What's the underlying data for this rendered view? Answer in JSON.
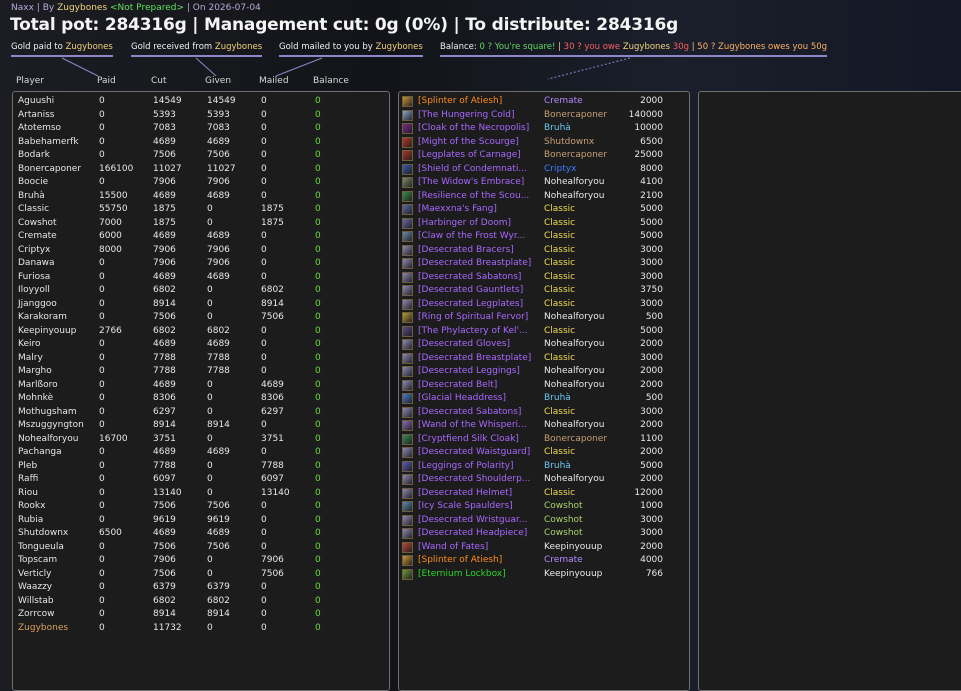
{
  "header": {
    "raid": "Naxx",
    "by_label": "By",
    "author": "Zugybones",
    "status": "<Not Prepared>",
    "on_label": "On",
    "date": "2026-07-04",
    "title": "Total pot: 284316g | Management cut: 0g (0%) | To distribute: 284316g"
  },
  "legend": {
    "paid_label": "Gold paid to",
    "received_label": "Gold received from",
    "mailed_label": "Gold mailed to you by",
    "name": "Zugybones",
    "balance_label": "Balance:",
    "square": "0 ? You're square!",
    "owe_pre": "30 ? you owe",
    "owe_amt": "30g",
    "owes_pre": "50 ? Zugybones owes you",
    "owes_amt": "50g",
    "sep": "|"
  },
  "columns": [
    "Player",
    "Paid",
    "Cut",
    "Given",
    "Mailed",
    "Balance"
  ],
  "players": [
    {
      "name": "Aguushi",
      "paid": "0",
      "cut": "14549",
      "given": "14549",
      "mailed": "0",
      "balance": "0"
    },
    {
      "name": "Artaniss",
      "paid": "0",
      "cut": "5393",
      "given": "5393",
      "mailed": "0",
      "balance": "0"
    },
    {
      "name": "Atotemso",
      "paid": "0",
      "cut": "7083",
      "given": "7083",
      "mailed": "0",
      "balance": "0"
    },
    {
      "name": "Babehamerfk",
      "paid": "0",
      "cut": "4689",
      "given": "4689",
      "mailed": "0",
      "balance": "0"
    },
    {
      "name": "Bodark",
      "paid": "0",
      "cut": "7506",
      "given": "7506",
      "mailed": "0",
      "balance": "0"
    },
    {
      "name": "Bonercaponer",
      "paid": "166100",
      "cut": "11027",
      "given": "11027",
      "mailed": "0",
      "balance": "0"
    },
    {
      "name": "Boocie",
      "paid": "0",
      "cut": "7906",
      "given": "7906",
      "mailed": "0",
      "balance": "0"
    },
    {
      "name": "Bruhà",
      "paid": "15500",
      "cut": "4689",
      "given": "4689",
      "mailed": "0",
      "balance": "0"
    },
    {
      "name": "Classic",
      "paid": "55750",
      "cut": "1875",
      "given": "0",
      "mailed": "1875",
      "balance": "0"
    },
    {
      "name": "Cowshot",
      "paid": "7000",
      "cut": "1875",
      "given": "0",
      "mailed": "1875",
      "balance": "0"
    },
    {
      "name": "Cremate",
      "paid": "6000",
      "cut": "4689",
      "given": "4689",
      "mailed": "0",
      "balance": "0"
    },
    {
      "name": "Criptyx",
      "paid": "8000",
      "cut": "7906",
      "given": "7906",
      "mailed": "0",
      "balance": "0"
    },
    {
      "name": "Danawa",
      "paid": "0",
      "cut": "7906",
      "given": "7906",
      "mailed": "0",
      "balance": "0"
    },
    {
      "name": "Furiosa",
      "paid": "0",
      "cut": "4689",
      "given": "4689",
      "mailed": "0",
      "balance": "0"
    },
    {
      "name": "Iloyyoll",
      "paid": "0",
      "cut": "6802",
      "given": "0",
      "mailed": "6802",
      "balance": "0"
    },
    {
      "name": "Jjanggoo",
      "paid": "0",
      "cut": "8914",
      "given": "0",
      "mailed": "8914",
      "balance": "0"
    },
    {
      "name": "Karakoram",
      "paid": "0",
      "cut": "7506",
      "given": "0",
      "mailed": "7506",
      "balance": "0"
    },
    {
      "name": "Keepinyouup",
      "paid": "2766",
      "cut": "6802",
      "given": "6802",
      "mailed": "0",
      "balance": "0"
    },
    {
      "name": "Keiro",
      "paid": "0",
      "cut": "4689",
      "given": "4689",
      "mailed": "0",
      "balance": "0"
    },
    {
      "name": "Malry",
      "paid": "0",
      "cut": "7788",
      "given": "7788",
      "mailed": "0",
      "balance": "0"
    },
    {
      "name": "Margho",
      "paid": "0",
      "cut": "7788",
      "given": "7788",
      "mailed": "0",
      "balance": "0"
    },
    {
      "name": "Marlßoro",
      "paid": "0",
      "cut": "4689",
      "given": "0",
      "mailed": "4689",
      "balance": "0"
    },
    {
      "name": "Mohnkè",
      "paid": "0",
      "cut": "8306",
      "given": "0",
      "mailed": "8306",
      "balance": "0"
    },
    {
      "name": "Mothugsham",
      "paid": "0",
      "cut": "6297",
      "given": "0",
      "mailed": "6297",
      "balance": "0"
    },
    {
      "name": "Mszuggyngton",
      "paid": "0",
      "cut": "8914",
      "given": "8914",
      "mailed": "0",
      "balance": "0"
    },
    {
      "name": "Nohealforyou",
      "paid": "16700",
      "cut": "3751",
      "given": "0",
      "mailed": "3751",
      "balance": "0"
    },
    {
      "name": "Pachanga",
      "paid": "0",
      "cut": "4689",
      "given": "4689",
      "mailed": "0",
      "balance": "0"
    },
    {
      "name": "Pleb",
      "paid": "0",
      "cut": "7788",
      "given": "0",
      "mailed": "7788",
      "balance": "0"
    },
    {
      "name": "Raffi",
      "paid": "0",
      "cut": "6097",
      "given": "0",
      "mailed": "6097",
      "balance": "0"
    },
    {
      "name": "Riou",
      "paid": "0",
      "cut": "13140",
      "given": "0",
      "mailed": "13140",
      "balance": "0"
    },
    {
      "name": "Rookx",
      "paid": "0",
      "cut": "7506",
      "given": "7506",
      "mailed": "0",
      "balance": "0"
    },
    {
      "name": "Rubia",
      "paid": "0",
      "cut": "9619",
      "given": "9619",
      "mailed": "0",
      "balance": "0"
    },
    {
      "name": "Shutdownx",
      "paid": "6500",
      "cut": "4689",
      "given": "4689",
      "mailed": "0",
      "balance": "0"
    },
    {
      "name": "Tongueula",
      "paid": "0",
      "cut": "7506",
      "given": "7506",
      "mailed": "0",
      "balance": "0"
    },
    {
      "name": "Topscam",
      "paid": "0",
      "cut": "7906",
      "given": "0",
      "mailed": "7906",
      "balance": "0"
    },
    {
      "name": "Verticly",
      "paid": "0",
      "cut": "7506",
      "given": "0",
      "mailed": "7506",
      "balance": "0"
    },
    {
      "name": "Waazzy",
      "paid": "0",
      "cut": "6379",
      "given": "6379",
      "mailed": "0",
      "balance": "0"
    },
    {
      "name": "Willstab",
      "paid": "0",
      "cut": "6802",
      "given": "6802",
      "mailed": "0",
      "balance": "0"
    },
    {
      "name": "Zorrcow",
      "paid": "0",
      "cut": "8914",
      "given": "8914",
      "mailed": "0",
      "balance": "0"
    },
    {
      "name": "Zugybones",
      "paid": "0",
      "cut": "11732",
      "given": "0",
      "mailed": "0",
      "balance": "0",
      "is_self": true
    }
  ],
  "loot": [
    {
      "item": "[Splinter of Atiesh]",
      "quality": "legendary",
      "icon": "splinter-icon",
      "icon_color": "#c9953a",
      "winner": "Cremate",
      "winner_color": "#b38cff",
      "amount": "2000"
    },
    {
      "item": "[The Hungering Cold]",
      "quality": "epic",
      "icon": "sword-icon",
      "icon_color": "#8aa6c8",
      "winner": "Bonercaponer",
      "winner_color": "#c89f74",
      "amount": "140000"
    },
    {
      "item": "[Cloak of the Necropolis]",
      "quality": "epic",
      "icon": "cloak-icon",
      "icon_color": "#7a2a8a",
      "winner": "Bruhà",
      "winner_color": "#6bc8f0",
      "amount": "10000"
    },
    {
      "item": "[Might of the Scourge]",
      "quality": "epic",
      "icon": "shoulder-icon",
      "icon_color": "#b83a2a",
      "winner": "Shutdownx",
      "winner_color": "#c89f74",
      "amount": "6500"
    },
    {
      "item": "[Legplates of Carnage]",
      "quality": "epic",
      "icon": "legs-icon",
      "icon_color": "#a83a2a",
      "winner": "Bonercaponer",
      "winner_color": "#c89f74",
      "amount": "25000"
    },
    {
      "item": "[Shield of Condemnati...",
      "quality": "epic",
      "icon": "shield-icon",
      "icon_color": "#3a5aa8",
      "winner": "Criptyx",
      "winner_color": "#3f7bff",
      "amount": "8000"
    },
    {
      "item": "[The Widow's Embrace]",
      "quality": "epic",
      "icon": "mace-icon",
      "icon_color": "#7a8a6a",
      "winner": "Nohealforyou",
      "winner_color": "#e8e8e8",
      "amount": "4100"
    },
    {
      "item": "[Resilience of the Scou...",
      "quality": "epic",
      "icon": "ring-icon",
      "icon_color": "#3a8a4a",
      "winner": "Nohealforyou",
      "winner_color": "#e8e8e8",
      "amount": "2100"
    },
    {
      "item": "[Maexxna's Fang]",
      "quality": "epic",
      "icon": "dagger-icon",
      "icon_color": "#5a6aa8",
      "winner": "Classic",
      "winner_color": "#f2dd50",
      "amount": "5000"
    },
    {
      "item": "[Harbinger of Doom]",
      "quality": "epic",
      "icon": "dagger-icon",
      "icon_color": "#6a6aa8",
      "winner": "Classic",
      "winner_color": "#f2dd50",
      "amount": "5000"
    },
    {
      "item": "[Claw of the Frost Wyr...",
      "quality": "epic",
      "icon": "claw-icon",
      "icon_color": "#6a8aa8",
      "winner": "Classic",
      "winner_color": "#f2dd50",
      "amount": "5000"
    },
    {
      "item": "[Desecrated Bracers]",
      "quality": "epic",
      "icon": "token-icon",
      "icon_color": "#8a8ab8",
      "winner": "Classic",
      "winner_color": "#f2dd50",
      "amount": "3000"
    },
    {
      "item": "[Desecrated Breastplate]",
      "quality": "epic",
      "icon": "token-icon",
      "icon_color": "#8a8ab8",
      "winner": "Classic",
      "winner_color": "#f2dd50",
      "amount": "3000"
    },
    {
      "item": "[Desecrated Sabatons]",
      "quality": "epic",
      "icon": "token-icon",
      "icon_color": "#8a8ab8",
      "winner": "Classic",
      "winner_color": "#f2dd50",
      "amount": "3000"
    },
    {
      "item": "[Desecrated Gauntlets]",
      "quality": "epic",
      "icon": "token-icon",
      "icon_color": "#8a8ab8",
      "winner": "Classic",
      "winner_color": "#f2dd50",
      "amount": "3750"
    },
    {
      "item": "[Desecrated Legplates]",
      "quality": "epic",
      "icon": "token-icon",
      "icon_color": "#8a8ab8",
      "winner": "Classic",
      "winner_color": "#f2dd50",
      "amount": "3000"
    },
    {
      "item": "[Ring of Spiritual Fervor]",
      "quality": "epic",
      "icon": "ring-icon",
      "icon_color": "#b89a3a",
      "winner": "Nohealforyou",
      "winner_color": "#e8e8e8",
      "amount": "500"
    },
    {
      "item": "[The Phylactery of Kel'...",
      "quality": "epic",
      "icon": "phylactery-icon",
      "icon_color": "#5a4a8a",
      "winner": "Classic",
      "winner_color": "#f2dd50",
      "amount": "5000"
    },
    {
      "item": "[Desecrated Gloves]",
      "quality": "epic",
      "icon": "token-icon",
      "icon_color": "#8a8ab8",
      "winner": "Nohealforyou",
      "winner_color": "#e8e8e8",
      "amount": "2000"
    },
    {
      "item": "[Desecrated Breastplate]",
      "quality": "epic",
      "icon": "token-icon",
      "icon_color": "#8a8ab8",
      "winner": "Classic",
      "winner_color": "#f2dd50",
      "amount": "3000"
    },
    {
      "item": "[Desecrated Leggings]",
      "quality": "epic",
      "icon": "token-icon",
      "icon_color": "#8a8ab8",
      "winner": "Nohealforyou",
      "winner_color": "#e8e8e8",
      "amount": "2000"
    },
    {
      "item": "[Desecrated Belt]",
      "quality": "epic",
      "icon": "token-icon",
      "icon_color": "#8a8ab8",
      "winner": "Nohealforyou",
      "winner_color": "#e8e8e8",
      "amount": "2000"
    },
    {
      "item": "[Glacial Headdress]",
      "quality": "epic",
      "icon": "helm-icon",
      "icon_color": "#4a7ac8",
      "winner": "Bruhà",
      "winner_color": "#6bc8f0",
      "amount": "500"
    },
    {
      "item": "[Desecrated Sabatons]",
      "quality": "epic",
      "icon": "token-icon",
      "icon_color": "#8a8ab8",
      "winner": "Classic",
      "winner_color": "#f2dd50",
      "amount": "3000"
    },
    {
      "item": "[Wand of the Whisperi...",
      "quality": "epic",
      "icon": "wand-icon",
      "icon_color": "#8a6ab8",
      "winner": "Nohealforyou",
      "winner_color": "#e8e8e8",
      "amount": "2000"
    },
    {
      "item": "[Cryptfiend Silk Cloak]",
      "quality": "epic",
      "icon": "cloak-icon",
      "icon_color": "#3a8a5a",
      "winner": "Bonercaponer",
      "winner_color": "#c89f74",
      "amount": "1100"
    },
    {
      "item": "[Desecrated Waistguard]",
      "quality": "epic",
      "icon": "token-icon",
      "icon_color": "#8a8ab8",
      "winner": "Classic",
      "winner_color": "#f2dd50",
      "amount": "2000"
    },
    {
      "item": "[Leggings of Polarity]",
      "quality": "epic",
      "icon": "legs-icon",
      "icon_color": "#5a5ab8",
      "winner": "Bruhà",
      "winner_color": "#6bc8f0",
      "amount": "5000"
    },
    {
      "item": "[Desecrated Shoulderp...",
      "quality": "epic",
      "icon": "token-icon",
      "icon_color": "#8a8ab8",
      "winner": "Nohealforyou",
      "winner_color": "#e8e8e8",
      "amount": "2000"
    },
    {
      "item": "[Desecrated Helmet]",
      "quality": "epic",
      "icon": "token-icon",
      "icon_color": "#8a8ab8",
      "winner": "Classic",
      "winner_color": "#f2dd50",
      "amount": "12000"
    },
    {
      "item": "[Icy Scale Spaulders]",
      "quality": "epic",
      "icon": "shoulder-icon",
      "icon_color": "#5a8ab8",
      "winner": "Cowshot",
      "winner_color": "#a8d36a",
      "amount": "1000"
    },
    {
      "item": "[Desecrated Wristguar...",
      "quality": "epic",
      "icon": "token-icon",
      "icon_color": "#8a8ab8",
      "winner": "Cowshot",
      "winner_color": "#a8d36a",
      "amount": "3000"
    },
    {
      "item": "[Desecrated Headpiece]",
      "quality": "epic",
      "icon": "token-icon",
      "icon_color": "#8a8ab8",
      "winner": "Cowshot",
      "winner_color": "#a8d36a",
      "amount": "3000"
    },
    {
      "item": "[Wand of Fates]",
      "quality": "epic",
      "icon": "wand-icon",
      "icon_color": "#b84a3a",
      "winner": "Keepinyouup",
      "winner_color": "#e8e8e8",
      "amount": "2000"
    },
    {
      "item": "[Splinter of Atiesh]",
      "quality": "legendary",
      "icon": "splinter-icon",
      "icon_color": "#c9953a",
      "winner": "Cremate",
      "winner_color": "#b38cff",
      "amount": "4000"
    },
    {
      "item": "[Eternium Lockbox]",
      "quality": "uncommon",
      "icon": "lockbox-icon",
      "icon_color": "#6a9a3a",
      "winner": "Keepinyouup",
      "winner_color": "#e8e8e8",
      "amount": "766"
    }
  ]
}
